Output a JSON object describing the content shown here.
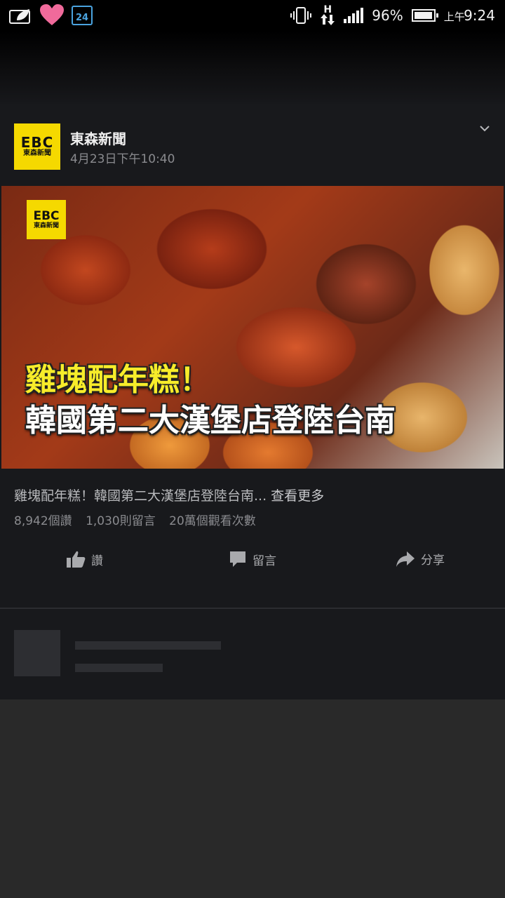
{
  "status_bar": {
    "calendar_day": "24",
    "network_type": "H",
    "battery_percent": "96%",
    "time_period": "上午",
    "time": "9:24",
    "battery_level": 0.96
  },
  "post": {
    "page_name": "東森新聞",
    "logo_text_top": "EBC",
    "logo_text_bottom": "東森新聞",
    "timestamp": "4月23日下午10:40",
    "video": {
      "headline_line1": "雞塊配年糕！",
      "headline_line2": "韓國第二大漢堡店登陸台南"
    },
    "caption": "雞塊配年糕！韓國第二大漢堡店登陸台南...",
    "see_more": "查看更多",
    "stats": {
      "reactions": "8,942個讚",
      "comments": "1,030則留言",
      "views": "20萬個觀看次數"
    },
    "actions": {
      "like": "讚",
      "comment": "留言",
      "share": "分享"
    }
  },
  "colors": {
    "logo_yellow": "#f5d900",
    "card_bg": "#18191c",
    "page_bg": "#292929"
  }
}
